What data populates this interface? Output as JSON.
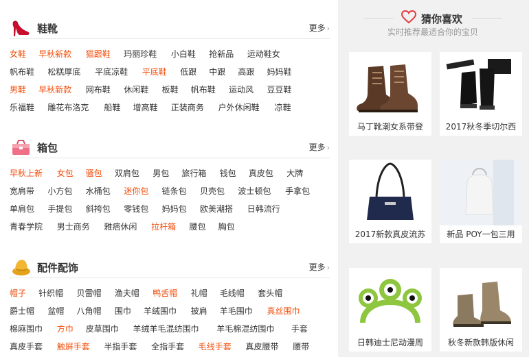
{
  "categories": [
    {
      "title": "鞋靴",
      "icon": "high-heel-icon",
      "more": "更多",
      "rows": [
        [
          {
            "t": "女鞋",
            "hot": true
          },
          {
            "t": "早秋新款",
            "hot": true
          },
          {
            "t": "猫跟鞋",
            "hot": true
          },
          {
            "t": "玛丽珍鞋"
          },
          {
            "t": "小白鞋"
          },
          {
            "t": "抢新品"
          },
          {
            "t": "运动鞋女"
          }
        ],
        [
          {
            "t": "帆布鞋"
          },
          {
            "t": "松糕厚底"
          },
          {
            "t": "平底凉鞋"
          },
          {
            "t": "平底鞋",
            "hot": true
          },
          {
            "t": "低跟"
          },
          {
            "t": "中跟"
          },
          {
            "t": "高跟"
          },
          {
            "t": "妈妈鞋"
          }
        ],
        [
          {
            "t": "男鞋",
            "hot": true
          },
          {
            "t": "早秋新款",
            "hot": true
          },
          {
            "t": "网布鞋"
          },
          {
            "t": "休闲鞋"
          },
          {
            "t": "板鞋"
          },
          {
            "t": "帆布鞋"
          },
          {
            "t": "运动风"
          },
          {
            "t": "豆豆鞋"
          }
        ],
        [
          {
            "t": "乐福鞋"
          },
          {
            "t": "雕花布洛克"
          },
          {
            "t": "船鞋"
          },
          {
            "t": "增高鞋"
          },
          {
            "t": "正装商务"
          },
          {
            "t": "户外休闲鞋"
          },
          {
            "t": "凉鞋"
          }
        ]
      ]
    },
    {
      "title": "箱包",
      "icon": "handbag-icon",
      "more": "更多",
      "rows": [
        [
          {
            "t": "早秋上新",
            "hot": true
          },
          {
            "t": "女包",
            "hot": true
          },
          {
            "t": "骚包",
            "hot": true
          },
          {
            "t": "双肩包"
          },
          {
            "t": "男包"
          },
          {
            "t": "旅行箱"
          },
          {
            "t": "钱包"
          },
          {
            "t": "真皮包"
          },
          {
            "t": "大牌"
          }
        ],
        [
          {
            "t": "宽肩带"
          },
          {
            "t": "小方包"
          },
          {
            "t": "水桶包"
          },
          {
            "t": "迷你包",
            "hot": true
          },
          {
            "t": "链条包"
          },
          {
            "t": "贝壳包"
          },
          {
            "t": "波士顿包"
          },
          {
            "t": "手拿包"
          }
        ],
        [
          {
            "t": "单肩包"
          },
          {
            "t": "手提包"
          },
          {
            "t": "斜挎包"
          },
          {
            "t": "零钱包"
          },
          {
            "t": "妈妈包"
          },
          {
            "t": "欧美潮搭"
          },
          {
            "t": "日韩流行"
          }
        ],
        [
          {
            "t": "青春学院"
          },
          {
            "t": "男士商务"
          },
          {
            "t": "雅痞休闲"
          },
          {
            "t": "拉杆箱",
            "hot": true
          },
          {
            "t": "腰包"
          },
          {
            "t": "胸包"
          }
        ]
      ]
    },
    {
      "title": "配件配饰",
      "icon": "hat-icon",
      "more": "更多",
      "rows": [
        [
          {
            "t": "帽子",
            "hot": true
          },
          {
            "t": "针织帽"
          },
          {
            "t": "贝雷帽"
          },
          {
            "t": "渔夫帽"
          },
          {
            "t": "鸭舌帽",
            "hot": true
          },
          {
            "t": "礼帽"
          },
          {
            "t": "毛线帽"
          },
          {
            "t": "套头帽"
          }
        ],
        [
          {
            "t": "爵士帽"
          },
          {
            "t": "盆帽"
          },
          {
            "t": "八角帽"
          },
          {
            "t": "围巾"
          },
          {
            "t": "羊绒围巾"
          },
          {
            "t": "披肩"
          },
          {
            "t": "羊毛围巾"
          },
          {
            "t": "真丝围巾",
            "hot": true
          }
        ],
        [
          {
            "t": "棉麻围巾"
          },
          {
            "t": "方巾",
            "hot": true
          },
          {
            "t": "皮草围巾"
          },
          {
            "t": "羊绒羊毛混纺围巾"
          },
          {
            "t": "羊毛棉混纺围巾"
          },
          {
            "t": "手套"
          }
        ],
        [
          {
            "t": "真皮手套"
          },
          {
            "t": "触屏手套",
            "hot": true
          },
          {
            "t": "半指手套"
          },
          {
            "t": "全指手套"
          },
          {
            "t": "毛线手套",
            "hot": true
          },
          {
            "t": "真皮腰带"
          },
          {
            "t": "腰带"
          }
        ]
      ]
    }
  ],
  "recommend": {
    "title": "猜你喜欢",
    "subtitle": "实时推荐最适合你的宝贝",
    "items": [
      {
        "caption": "马丁靴潮女系带登",
        "thumb": "brown-boots"
      },
      {
        "caption": "2017秋冬季切尔西",
        "thumb": "black-boots"
      },
      {
        "caption": "2017新款真皮流苏",
        "thumb": "navy-handbag"
      },
      {
        "caption": "新品 POY一包三用",
        "thumb": "white-backpack"
      },
      {
        "caption": "日韩迪士尼动漫周",
        "thumb": "alien-headband"
      },
      {
        "caption": "秋冬新款韩版休闲",
        "thumb": "khaki-boots"
      }
    ]
  },
  "colors": {
    "hot": "#f24f0c",
    "accent": "#e4393c",
    "panel": "#f1f1f1"
  }
}
